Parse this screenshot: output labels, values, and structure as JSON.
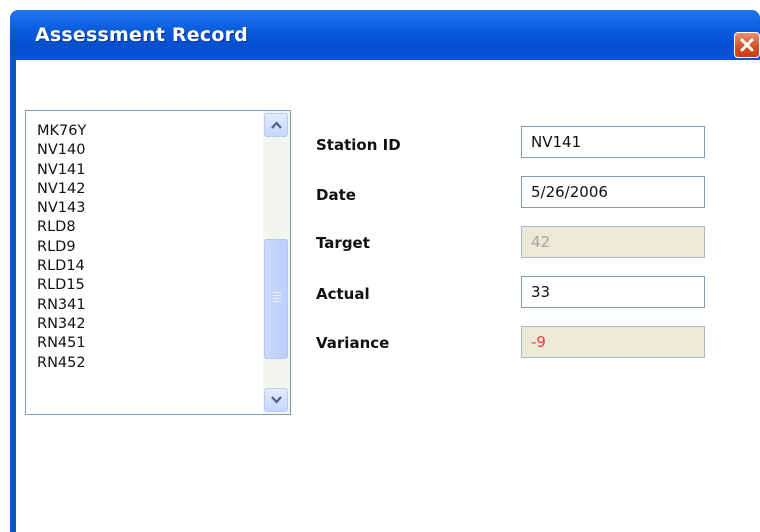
{
  "window": {
    "title": "Assessment Record"
  },
  "station_list": {
    "items": [
      "MK76Y",
      "NV140",
      "NV141",
      "NV142",
      "NV143",
      "RLD8",
      "RLD9",
      "RLD14",
      "RLD15",
      "RN341",
      "RN342",
      "RN451",
      "RN452"
    ]
  },
  "form": {
    "station_id": {
      "label": "Station ID",
      "value": "NV141"
    },
    "date": {
      "label": "Date",
      "value": "5/26/2006"
    },
    "target": {
      "label": "Target",
      "value": "42"
    },
    "actual": {
      "label": "Actual",
      "value": "33"
    },
    "variance": {
      "label": "Variance",
      "value": "-9"
    }
  }
}
